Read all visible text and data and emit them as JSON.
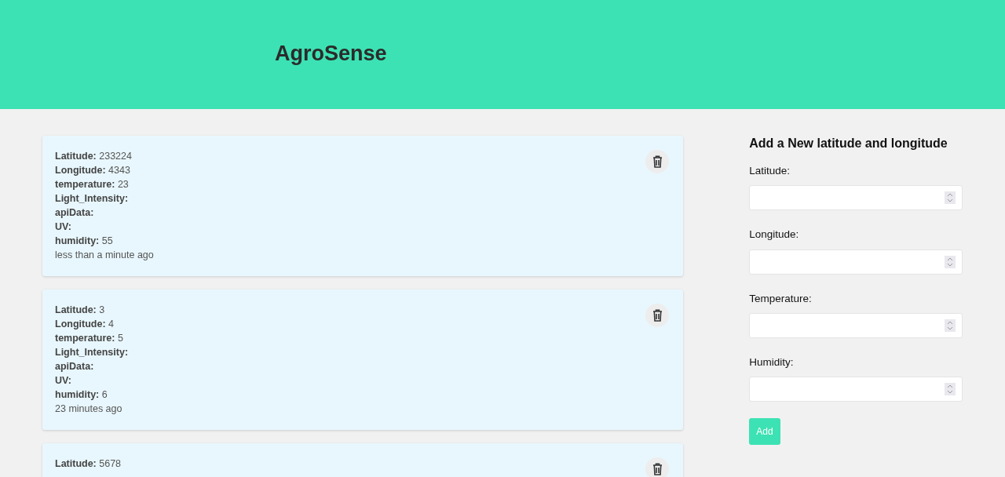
{
  "header": {
    "title": "AgroSense"
  },
  "records": [
    {
      "fields": [
        {
          "label": "Latitude:",
          "value": "233224"
        },
        {
          "label": "Longitude:",
          "value": "4343"
        },
        {
          "label": "temperature:",
          "value": "23"
        },
        {
          "label": "Light_Intensity:"
        },
        {
          "label": "apiData:"
        },
        {
          "label": "UV:"
        },
        {
          "label": "humidity:",
          "value": "55"
        }
      ],
      "time": "less than a minute ago"
    },
    {
      "fields": [
        {
          "label": "Latitude:",
          "value": "3"
        },
        {
          "label": "Longitude:",
          "value": "4"
        },
        {
          "label": "temperature:",
          "value": "5"
        },
        {
          "label": "Light_Intensity:"
        },
        {
          "label": "apiData:"
        },
        {
          "label": "UV:"
        },
        {
          "label": "humidity:",
          "value": "6"
        }
      ],
      "time": "23 minutes ago"
    },
    {
      "fields": [
        {
          "label": "Latitude:",
          "value": "5678"
        }
      ]
    }
  ],
  "form": {
    "title": "Add a New latitude and longitude",
    "fields": [
      {
        "label": "Latitude:"
      },
      {
        "label": "Longitude:"
      },
      {
        "label": "Temperature:"
      },
      {
        "label": "Humidity:"
      }
    ],
    "button": "Add"
  }
}
